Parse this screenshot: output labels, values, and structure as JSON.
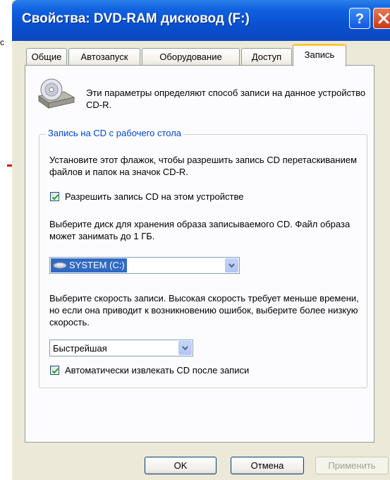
{
  "stray_char": "c",
  "window": {
    "title": "Свойства: DVD-RAM дисковод (F:)",
    "help_label": "?"
  },
  "tabs": [
    {
      "label": "Общие"
    },
    {
      "label": "Автозапуск"
    },
    {
      "label": "Оборудование"
    },
    {
      "label": "Доступ"
    },
    {
      "label": "Запись",
      "active": true
    }
  ],
  "intro_text": "Эти параметры определяют способ записи на данное устройство CD-R.",
  "group": {
    "label": "Запись на CD с рабочего стола",
    "description": "Установите этот флажок, чтобы разрешить запись CD перетаскиванием файлов и папок на значок CD-R.",
    "enable_checkbox": {
      "label": "Разрешить запись CD на этом устройстве",
      "checked": true
    },
    "disk_text": "Выберите диск для хранения образа записываемого CD. Файл образа может занимать до 1 ГБ.",
    "disk_select": {
      "value": "SYSTEM (C:)"
    },
    "speed_text": "Выберите скорость записи. Высокая скорость требует меньше времени, но если она приводит к возникновению ошибок, выберите более низкую скорость.",
    "speed_select": {
      "value": "Быстрейшая"
    },
    "eject_checkbox": {
      "label": "Автоматически извлекать CD после записи",
      "checked": true
    }
  },
  "buttons": {
    "ok": "OK",
    "cancel": "Отмена",
    "apply": "Применить"
  },
  "colors": {
    "titlebar": "#0a50d0",
    "group_label": "#0046d5",
    "selection": "#316ac5",
    "active_tab_accent": "#ffc83c",
    "annotation_line": "#e00000"
  }
}
